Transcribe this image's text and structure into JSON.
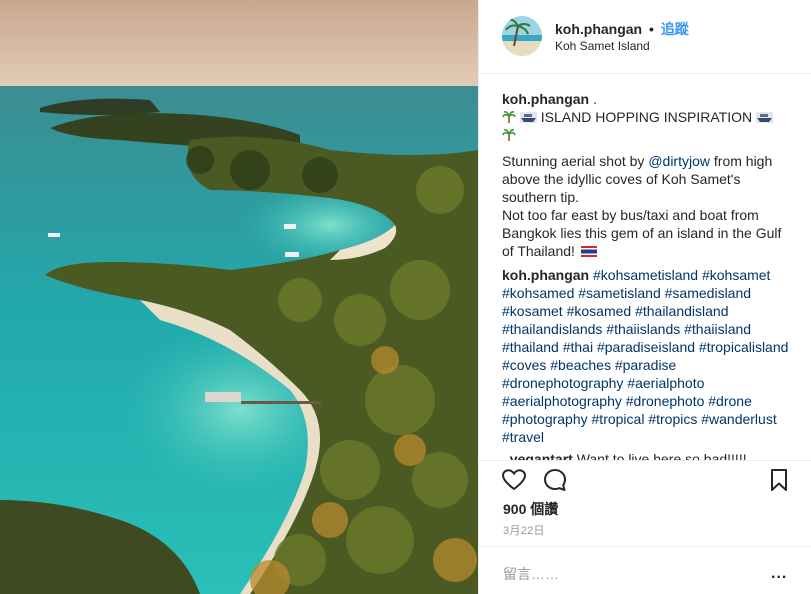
{
  "post": {
    "username": "koh.phangan",
    "separator": "•",
    "follow_label": "追蹤",
    "location": "Koh Samet Island"
  },
  "caption": {
    "username": "koh.phangan",
    "username_suffix": " .",
    "heading": "ISLAND HOPPING INSPIRATION",
    "line1_prefix": "Stunning aerial shot by ",
    "mention": "@dirtyjow",
    "line1_suffix": " from high above the idyllic coves of Koh Samet's southern tip.",
    "line2": "Not too far east by bus/taxi and boat from Bangkok lies this gem of an island in the Gulf of Thailand!",
    "comment_username": "koh.phangan",
    "hashtags": "#kohsametisland #kohsamet #kohsamed #sametisland #samedisland #kosamet #kosamed #thailandisland #thailandislands #thaiislands #thaiisland #thailand #thai #paradiseisland #tropicalisland #coves #beaches #paradise #dronephotography #aerialphoto #aerialphotography #dronephoto #drone #photography #tropical #tropics #wanderlust #travel",
    "reply_username": "_vegantart",
    "reply_text": "Want to live here so bad!!!!!"
  },
  "actions": {
    "like_icon": "heart-icon",
    "comment_icon": "comment-bubble-icon",
    "save_icon": "bookmark-icon"
  },
  "stats": {
    "views": "900 個讚",
    "date": "3月22日"
  },
  "comment_bar": {
    "placeholder": "留言……",
    "more": "..."
  },
  "colors": {
    "link": "#003569",
    "follow": "#3897f0",
    "muted": "#999999",
    "sea": "#2bb3b8",
    "forest": "#3b4a1e"
  }
}
